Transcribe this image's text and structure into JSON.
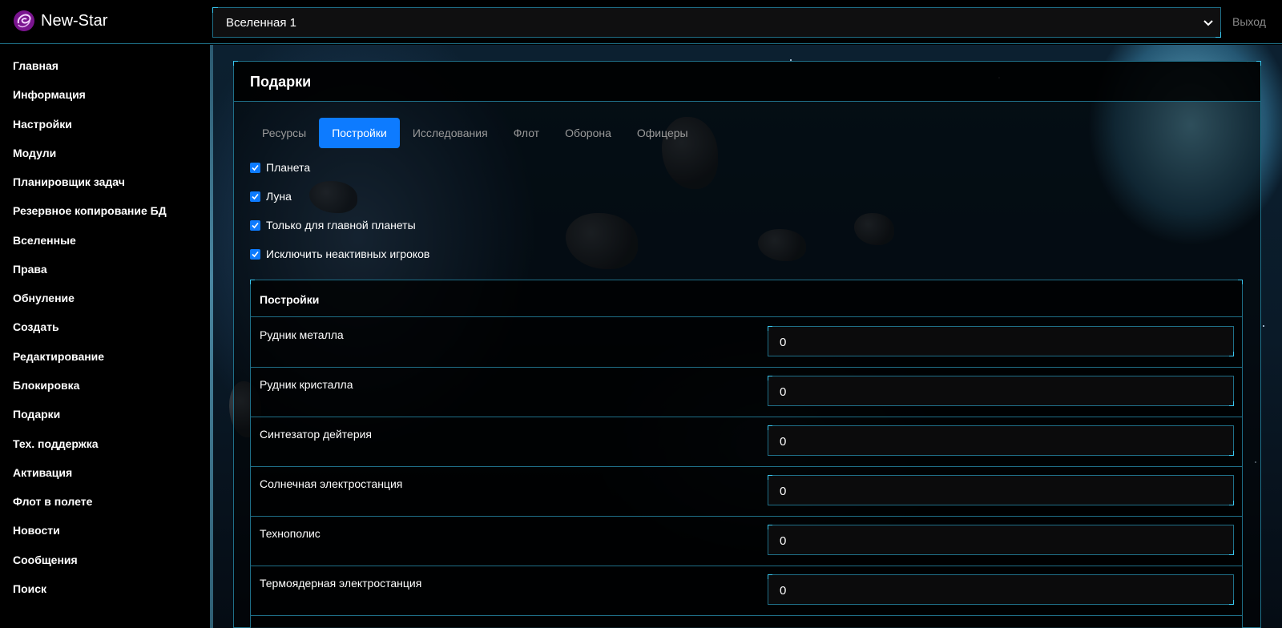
{
  "brand": {
    "name": "New-Star",
    "logo_icon": "galaxy-swirl-icon",
    "accent": "#8a1fa6"
  },
  "header": {
    "universe_select": {
      "value": "Вселенная 1"
    },
    "logout_label": "Выход"
  },
  "sidebar": {
    "items": [
      {
        "label": "Главная"
      },
      {
        "label": "Информация"
      },
      {
        "label": "Настройки"
      },
      {
        "label": "Модули"
      },
      {
        "label": "Планировщик задач"
      },
      {
        "label": "Резервное копирование БД"
      },
      {
        "label": "Вселенные"
      },
      {
        "label": "Права"
      },
      {
        "label": "Обнуление"
      },
      {
        "label": "Создать"
      },
      {
        "label": "Редактирование"
      },
      {
        "label": "Блокировка"
      },
      {
        "label": "Подарки"
      },
      {
        "label": "Тех. поддержка"
      },
      {
        "label": "Активация"
      },
      {
        "label": "Флот в полете"
      },
      {
        "label": "Новости"
      },
      {
        "label": "Сообщения"
      },
      {
        "label": "Поиск"
      }
    ]
  },
  "main": {
    "title": "Подарки",
    "tabs": [
      {
        "label": "Ресурсы",
        "active": false
      },
      {
        "label": "Постройки",
        "active": true
      },
      {
        "label": "Исследования",
        "active": false
      },
      {
        "label": "Флот",
        "active": false
      },
      {
        "label": "Оборона",
        "active": false
      },
      {
        "label": "Офицеры",
        "active": false
      }
    ],
    "options": [
      {
        "label": "Планета",
        "checked": true
      },
      {
        "label": "Луна",
        "checked": true
      },
      {
        "label": "Только для главной планеты",
        "checked": true
      },
      {
        "label": "Исключить неактивных игроков",
        "checked": true
      }
    ],
    "table": {
      "header": "Постройки",
      "rows": [
        {
          "label": "Рудник металла",
          "value": "0"
        },
        {
          "label": "Рудник кристалла",
          "value": "0"
        },
        {
          "label": "Синтезатор дейтерия",
          "value": "0"
        },
        {
          "label": "Солнечная электростанция",
          "value": "0"
        },
        {
          "label": "Технополис",
          "value": "0"
        },
        {
          "label": "Термоядерная электростанция",
          "value": "0"
        }
      ]
    }
  },
  "colors": {
    "accent_blue": "#0d7bff",
    "border_cyan": "#1f6f88",
    "corner_cyan": "#37c6ef"
  }
}
